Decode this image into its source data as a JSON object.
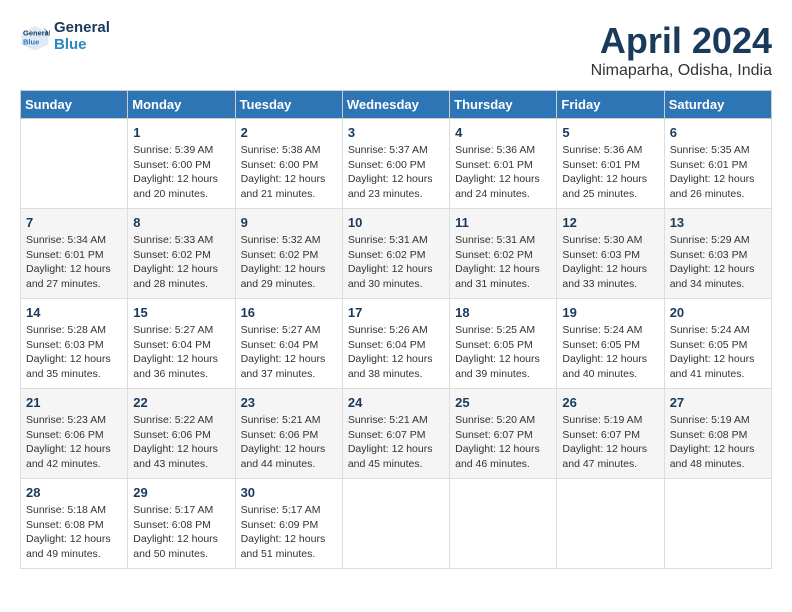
{
  "header": {
    "logo_line1": "General",
    "logo_line2": "Blue",
    "title": "April 2024",
    "subtitle": "Nimaparha, Odisha, India"
  },
  "days_of_week": [
    "Sunday",
    "Monday",
    "Tuesday",
    "Wednesday",
    "Thursday",
    "Friday",
    "Saturday"
  ],
  "weeks": [
    [
      {
        "day": "",
        "content": ""
      },
      {
        "day": "1",
        "content": "Sunrise: 5:39 AM\nSunset: 6:00 PM\nDaylight: 12 hours\nand 20 minutes."
      },
      {
        "day": "2",
        "content": "Sunrise: 5:38 AM\nSunset: 6:00 PM\nDaylight: 12 hours\nand 21 minutes."
      },
      {
        "day": "3",
        "content": "Sunrise: 5:37 AM\nSunset: 6:00 PM\nDaylight: 12 hours\nand 23 minutes."
      },
      {
        "day": "4",
        "content": "Sunrise: 5:36 AM\nSunset: 6:01 PM\nDaylight: 12 hours\nand 24 minutes."
      },
      {
        "day": "5",
        "content": "Sunrise: 5:36 AM\nSunset: 6:01 PM\nDaylight: 12 hours\nand 25 minutes."
      },
      {
        "day": "6",
        "content": "Sunrise: 5:35 AM\nSunset: 6:01 PM\nDaylight: 12 hours\nand 26 minutes."
      }
    ],
    [
      {
        "day": "7",
        "content": "Sunrise: 5:34 AM\nSunset: 6:01 PM\nDaylight: 12 hours\nand 27 minutes."
      },
      {
        "day": "8",
        "content": "Sunrise: 5:33 AM\nSunset: 6:02 PM\nDaylight: 12 hours\nand 28 minutes."
      },
      {
        "day": "9",
        "content": "Sunrise: 5:32 AM\nSunset: 6:02 PM\nDaylight: 12 hours\nand 29 minutes."
      },
      {
        "day": "10",
        "content": "Sunrise: 5:31 AM\nSunset: 6:02 PM\nDaylight: 12 hours\nand 30 minutes."
      },
      {
        "day": "11",
        "content": "Sunrise: 5:31 AM\nSunset: 6:02 PM\nDaylight: 12 hours\nand 31 minutes."
      },
      {
        "day": "12",
        "content": "Sunrise: 5:30 AM\nSunset: 6:03 PM\nDaylight: 12 hours\nand 33 minutes."
      },
      {
        "day": "13",
        "content": "Sunrise: 5:29 AM\nSunset: 6:03 PM\nDaylight: 12 hours\nand 34 minutes."
      }
    ],
    [
      {
        "day": "14",
        "content": "Sunrise: 5:28 AM\nSunset: 6:03 PM\nDaylight: 12 hours\nand 35 minutes."
      },
      {
        "day": "15",
        "content": "Sunrise: 5:27 AM\nSunset: 6:04 PM\nDaylight: 12 hours\nand 36 minutes."
      },
      {
        "day": "16",
        "content": "Sunrise: 5:27 AM\nSunset: 6:04 PM\nDaylight: 12 hours\nand 37 minutes."
      },
      {
        "day": "17",
        "content": "Sunrise: 5:26 AM\nSunset: 6:04 PM\nDaylight: 12 hours\nand 38 minutes."
      },
      {
        "day": "18",
        "content": "Sunrise: 5:25 AM\nSunset: 6:05 PM\nDaylight: 12 hours\nand 39 minutes."
      },
      {
        "day": "19",
        "content": "Sunrise: 5:24 AM\nSunset: 6:05 PM\nDaylight: 12 hours\nand 40 minutes."
      },
      {
        "day": "20",
        "content": "Sunrise: 5:24 AM\nSunset: 6:05 PM\nDaylight: 12 hours\nand 41 minutes."
      }
    ],
    [
      {
        "day": "21",
        "content": "Sunrise: 5:23 AM\nSunset: 6:06 PM\nDaylight: 12 hours\nand 42 minutes."
      },
      {
        "day": "22",
        "content": "Sunrise: 5:22 AM\nSunset: 6:06 PM\nDaylight: 12 hours\nand 43 minutes."
      },
      {
        "day": "23",
        "content": "Sunrise: 5:21 AM\nSunset: 6:06 PM\nDaylight: 12 hours\nand 44 minutes."
      },
      {
        "day": "24",
        "content": "Sunrise: 5:21 AM\nSunset: 6:07 PM\nDaylight: 12 hours\nand 45 minutes."
      },
      {
        "day": "25",
        "content": "Sunrise: 5:20 AM\nSunset: 6:07 PM\nDaylight: 12 hours\nand 46 minutes."
      },
      {
        "day": "26",
        "content": "Sunrise: 5:19 AM\nSunset: 6:07 PM\nDaylight: 12 hours\nand 47 minutes."
      },
      {
        "day": "27",
        "content": "Sunrise: 5:19 AM\nSunset: 6:08 PM\nDaylight: 12 hours\nand 48 minutes."
      }
    ],
    [
      {
        "day": "28",
        "content": "Sunrise: 5:18 AM\nSunset: 6:08 PM\nDaylight: 12 hours\nand 49 minutes."
      },
      {
        "day": "29",
        "content": "Sunrise: 5:17 AM\nSunset: 6:08 PM\nDaylight: 12 hours\nand 50 minutes."
      },
      {
        "day": "30",
        "content": "Sunrise: 5:17 AM\nSunset: 6:09 PM\nDaylight: 12 hours\nand 51 minutes."
      },
      {
        "day": "",
        "content": ""
      },
      {
        "day": "",
        "content": ""
      },
      {
        "day": "",
        "content": ""
      },
      {
        "day": "",
        "content": ""
      }
    ]
  ]
}
